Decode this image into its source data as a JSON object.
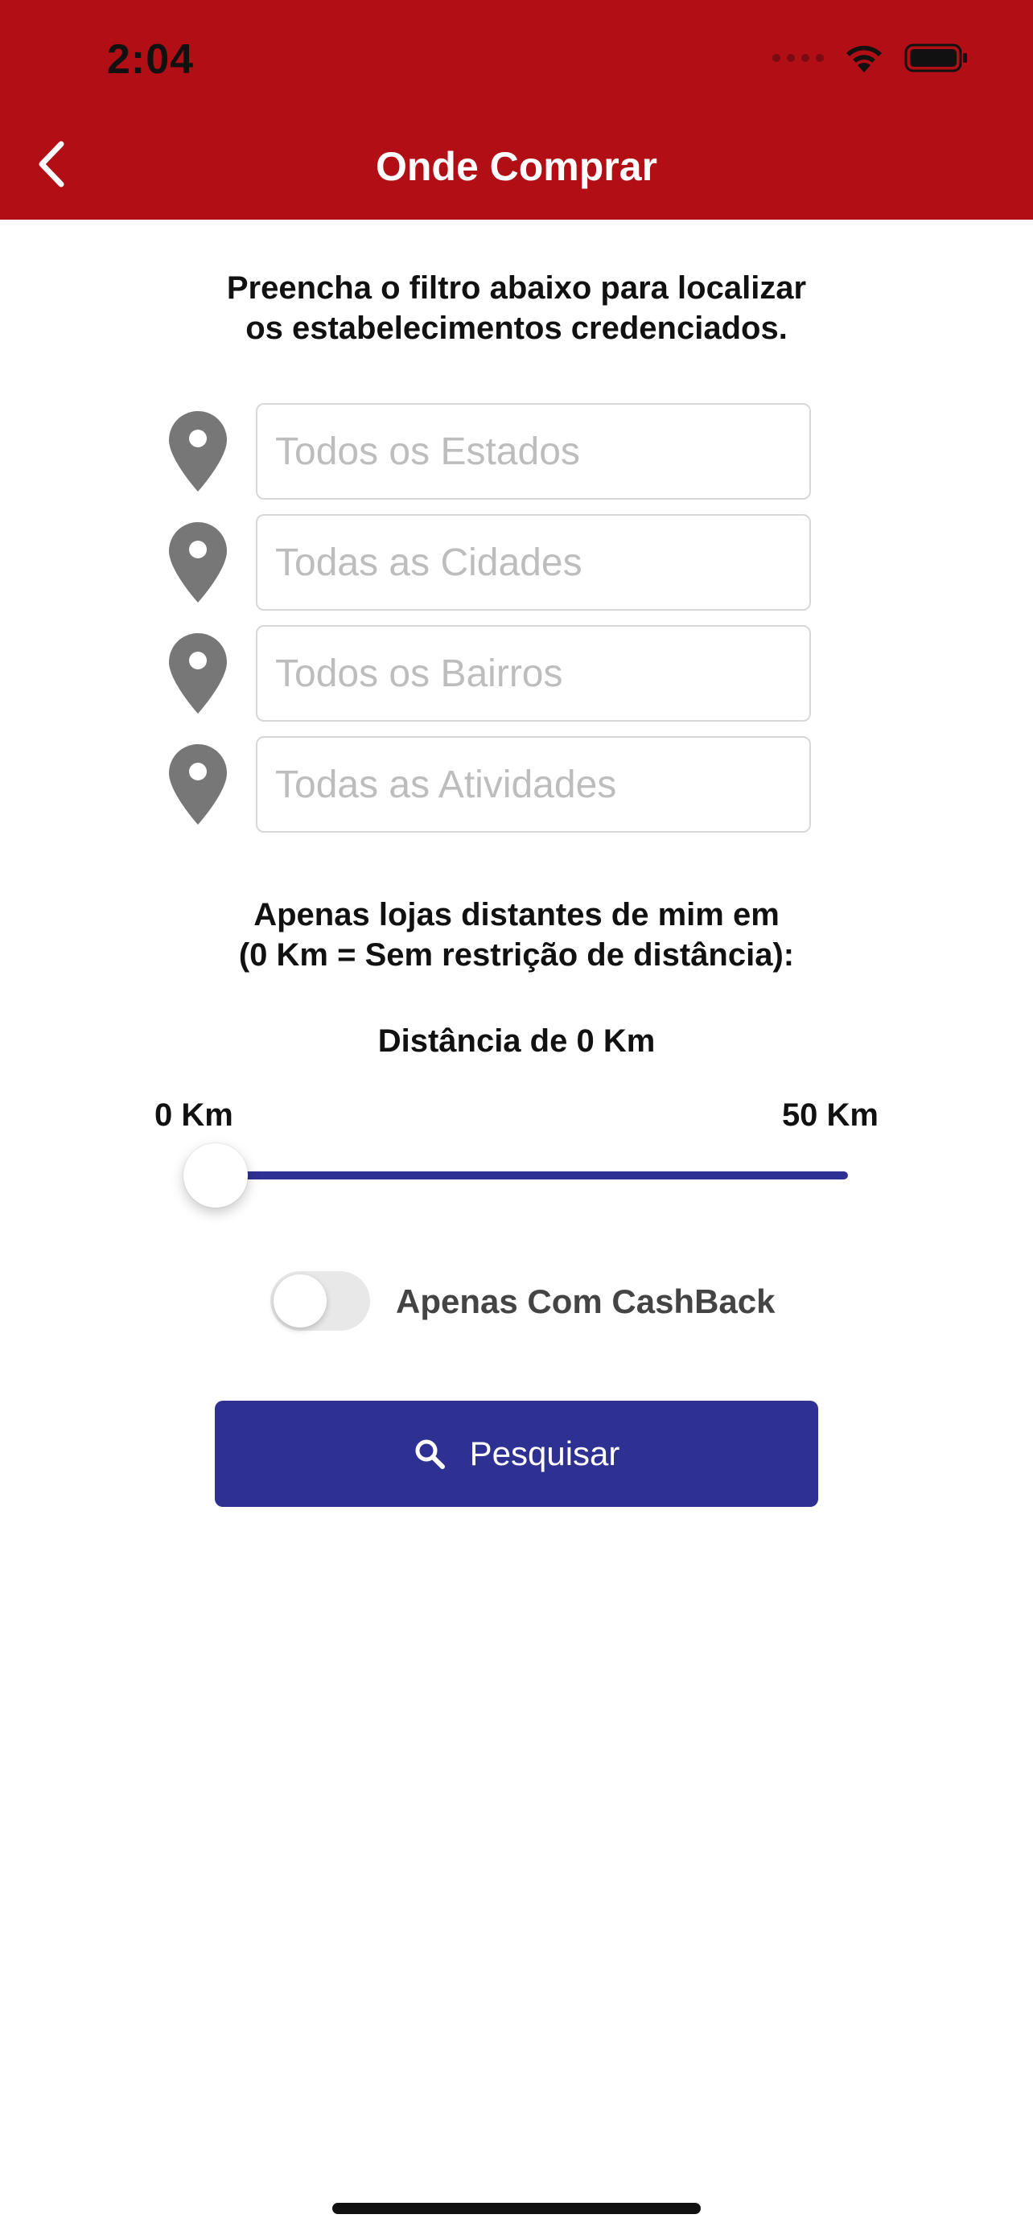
{
  "status_bar": {
    "time": "2:04"
  },
  "nav": {
    "title": "Onde Comprar",
    "back_icon": "chevron-left-icon"
  },
  "intro_text": "Preencha o filtro abaixo para localizar\nos estabelecimentos credenciados.",
  "filters": [
    {
      "placeholder": "Todos os Estados",
      "icon": "map-pin-icon"
    },
    {
      "placeholder": "Todas as Cidades",
      "icon": "map-pin-icon"
    },
    {
      "placeholder": "Todos os Bairros",
      "icon": "map-pin-icon"
    },
    {
      "placeholder": "Todas as Atividades",
      "icon": "map-pin-icon"
    }
  ],
  "distance": {
    "description": "Apenas lojas distantes de mim em\n(0 Km = Sem restrição de distância):",
    "title": "Distância de 0 Km",
    "min_label": "0 Km",
    "max_label": "50 Km",
    "value_km": 0
  },
  "cashback": {
    "label": "Apenas Com CashBack",
    "enabled": false
  },
  "search_button": {
    "label": "Pesquisar",
    "icon": "search-icon"
  },
  "colors": {
    "header": "#b20e16",
    "accent": "#2e3192",
    "pin": "#777777"
  }
}
